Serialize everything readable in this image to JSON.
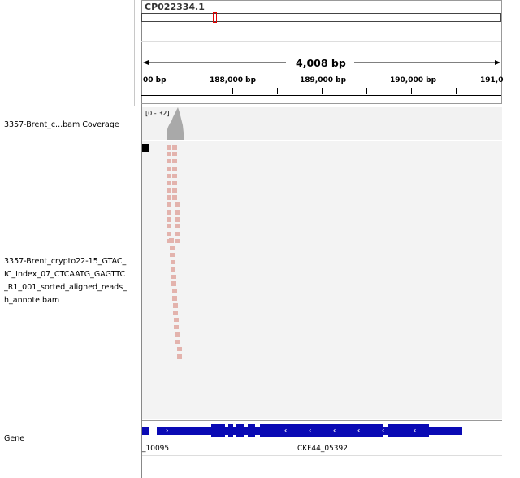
{
  "ruler": {
    "chromosome": "CP022334.1",
    "span_label": "4,008 bp",
    "ticks": [
      "00 bp",
      "188,000 bp",
      "189,000 bp",
      "190,000 bp",
      "191,0"
    ]
  },
  "tracks": {
    "coverage": {
      "name": "3357-Brent_c...bam Coverage",
      "range": "[0 - 32]"
    },
    "alignment": {
      "name_lines": [
        "3357-Brent_crypto22-15_GTAC_",
        "IC_Index_07_CTCAATG_GAGTTC",
        "_R1_001_sorted_aligned_reads_",
        "h_annote.bam"
      ]
    },
    "gene": {
      "name": "Gene",
      "features": [
        "_10095",
        "CKF44_05392"
      ]
    }
  },
  "colors": {
    "read_fill": "#e3b3ad",
    "coverage_fill": "#a9a9a9",
    "gene_fill": "#0a0ab4",
    "locator": "#e00000"
  }
}
